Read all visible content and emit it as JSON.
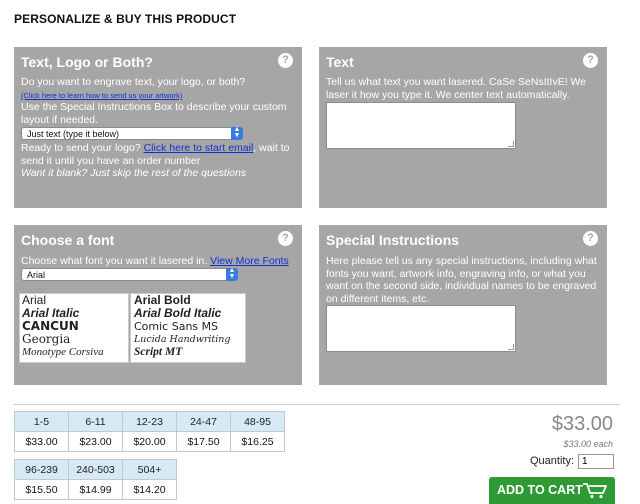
{
  "page_title": "PERSONALIZE & BUY THIS PRODUCT",
  "help_glyph": "?",
  "panels": {
    "text_logo": {
      "title": "Text, Logo or Both?",
      "question": "Do you want to engrave text, your logo, or both?",
      "artwork_link": "(Click here to learn how to send us your artwork)",
      "instructions_line": "Use the Special Instructions Box to describe your custom layout if needed.",
      "select_value": "Just text (type it below)",
      "ready_prefix": "Ready to send your logo?",
      "ready_link": "Click here to start email",
      "ready_suffix": ", wait to send it until you have an order number",
      "blank_note": "Want it blank? Just skip the rest of the questions"
    },
    "text": {
      "title": "Text",
      "description": "Tell us what text you want lasered. CaSe SeNsItIvE! We laser it how you type it. We center text automatically.",
      "textarea_value": ""
    },
    "font": {
      "title": "Choose a font",
      "prompt": "Choose what font you want it lasered in.",
      "more_link": "View More Fonts",
      "select_value": "Arial",
      "samples_left": [
        "Arial",
        "Arial Italic",
        "CANCUN",
        "Georgia",
        "Monotype Corsiva"
      ],
      "samples_right": [
        "Arial Bold",
        "Arial Bold Italic",
        "Comic Sans MS",
        "Lucida Handwriting",
        "Script MT"
      ]
    },
    "special": {
      "title": "Special Instructions",
      "description": "Here please tell us any special instructions, including what fonts you want, artwork info, engraving info, or what you want on the second side, individual names to be engraved on different items, etc.",
      "textarea_value": ""
    }
  },
  "pricing": {
    "row1": {
      "quantities": [
        "1-5",
        "6-11",
        "12-23",
        "24-47",
        "48-95"
      ],
      "prices": [
        "$33.00",
        "$23.00",
        "$20.00",
        "$17.50",
        "$16.25"
      ]
    },
    "row2": {
      "quantities": [
        "96-239",
        "240-503",
        "504+"
      ],
      "prices": [
        "$15.50",
        "$14.99",
        "$14.20"
      ]
    }
  },
  "summary": {
    "price": "$33.00",
    "price_each": "$33.00 each",
    "quantity_label": "Quantity:",
    "quantity_value": "1",
    "cart_label": "ADD TO CART"
  },
  "colors": {
    "panel_bg": "#a6a6a6",
    "link": "#1133cc",
    "cart_green": "#2e9a35",
    "tier_header": "#d7e9f3"
  },
  "icons": {
    "help": "question-circle-icon",
    "select_arrows": "up-down-chevron-icon",
    "cart": "shopping-cart-icon"
  }
}
